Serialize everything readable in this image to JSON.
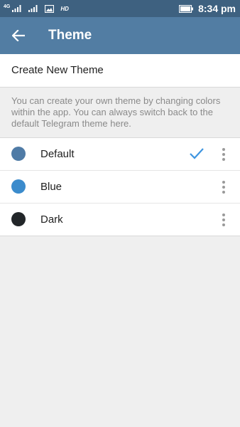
{
  "status_bar": {
    "net_label": "4G",
    "hd_label": "HD",
    "time": "8:34 pm",
    "icons": [
      "signal-icon",
      "signal-icon",
      "image-icon",
      "battery-icon"
    ]
  },
  "app_bar": {
    "title": "Theme",
    "back_icon": "arrow-left-icon"
  },
  "create_theme": {
    "label": "Create New Theme"
  },
  "info": {
    "text": "You can create your own theme by changing colors within the app. You can always switch back to the default Telegram theme here."
  },
  "themes": [
    {
      "name": "Default",
      "color": "#4f7ba6",
      "selected": true
    },
    {
      "name": "Blue",
      "color": "#3b8bcc",
      "selected": false
    },
    {
      "name": "Dark",
      "color": "#222629",
      "selected": false
    }
  ],
  "colors": {
    "status_bar": "#3e6180",
    "app_bar": "#527da3",
    "check": "#3e95e0",
    "background": "#efefef"
  }
}
